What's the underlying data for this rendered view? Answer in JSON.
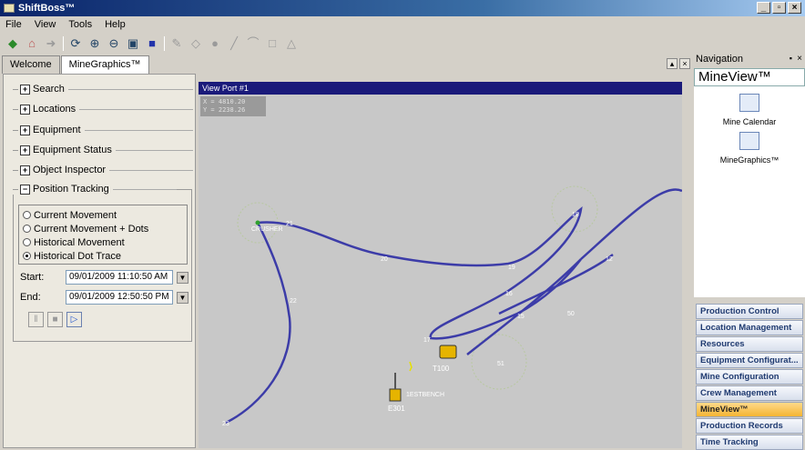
{
  "window": {
    "title": "ShiftBoss™",
    "controls": [
      "_",
      "▫",
      "×"
    ]
  },
  "menu": [
    "File",
    "View",
    "Tools",
    "Help"
  ],
  "tabs": [
    {
      "label": "Welcome"
    },
    {
      "label": "MineGraphics™"
    }
  ],
  "left_panel": {
    "sections": [
      "Search",
      "Locations",
      "Equipment",
      "Equipment Status",
      "Object Inspector"
    ],
    "position_tracking": {
      "title": "Position Tracking",
      "options": [
        "Current Movement",
        "Current Movement + Dots",
        "Historical Movement",
        "Historical Dot Trace"
      ],
      "selected": "Historical Dot Trace",
      "start_label": "Start:",
      "start_value": "09/01/2009 11:10:50 AM",
      "end_label": "End:",
      "end_value": "09/01/2009 12:50:50 PM"
    }
  },
  "viewport": {
    "title": "View Port #1",
    "x_readout": "X = 4810.20",
    "y_readout": "Y = 2238.26",
    "labels": {
      "crusher": "CRUSHER",
      "n21": "21",
      "n20": "20",
      "n22": "22",
      "n23": "23",
      "n18": "18",
      "n19": "19",
      "n16": "16",
      "n15": "15",
      "n17": "17",
      "n12": "12",
      "n50": "50",
      "n51": "51",
      "t100": "T100",
      "bench": "1ESTBENCH",
      "e301": "E301"
    },
    "route_color": "#3c3ca8",
    "truck_color": "#e6b400"
  },
  "navigation": {
    "header": "Navigation",
    "title": "MineView™",
    "items": [
      {
        "label": "Mine Calendar"
      },
      {
        "label": "MineGraphics™"
      }
    ],
    "buttons": [
      {
        "label": "Production Control"
      },
      {
        "label": "Location Management"
      },
      {
        "label": "Resources"
      },
      {
        "label": "Equipment Configurat..."
      },
      {
        "label": "Mine Configuration"
      },
      {
        "label": "Crew Management"
      },
      {
        "label": "MineView™"
      },
      {
        "label": "Production Records"
      },
      {
        "label": "Time Tracking"
      }
    ],
    "active_button": "MineView™"
  }
}
